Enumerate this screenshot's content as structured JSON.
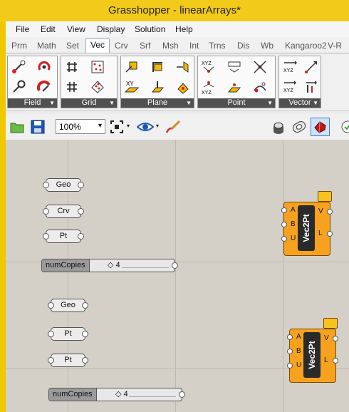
{
  "window": {
    "title": "Grasshopper - linearArrays*"
  },
  "menu": [
    "File",
    "Edit",
    "View",
    "Display",
    "Solution",
    "Help"
  ],
  "tabs": [
    "Prm",
    "Math",
    "Set",
    "Vec",
    "Crv",
    "Srf",
    "Msh",
    "Int",
    "Trns",
    "Dis",
    "Wb",
    "Kangaroo2",
    "V-R"
  ],
  "active_tab": "Vec",
  "ribbon_groups": [
    "Field",
    "Grid",
    "Plane",
    "Point",
    "Vector"
  ],
  "toolbar": {
    "zoom": "100%"
  },
  "canvas": {
    "params_top": [
      "Geo",
      "Crv",
      "Pt"
    ],
    "slider_top": {
      "label": "numCopies",
      "value": "◇ 4"
    },
    "params_bottom": [
      "Geo",
      "Pt",
      "Pt"
    ],
    "slider_bottom": {
      "label": "numCopies",
      "value": "◇ 4"
    },
    "component": {
      "name": "Vec2Pt",
      "inputs": [
        "A",
        "B",
        "U"
      ],
      "outputs": [
        "V",
        "L"
      ]
    }
  },
  "colors": {
    "title_bar": "#f2cb1a",
    "component": "#f7a21f",
    "canvas": "#d4d0c8"
  }
}
